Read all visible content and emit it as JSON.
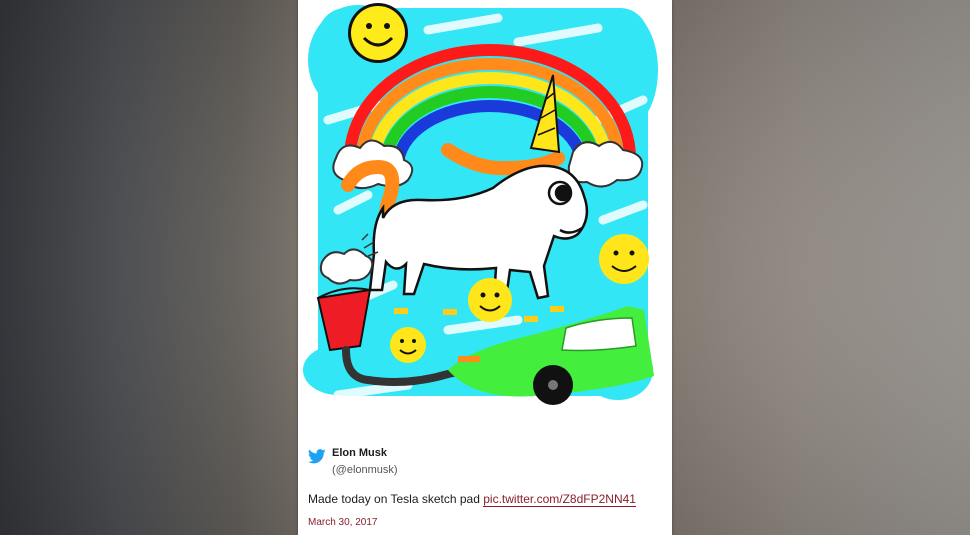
{
  "tweet": {
    "author_name": "Elon Musk",
    "author_handle": "(@elonmusk)",
    "text": "Made today on Tesla sketch pad",
    "link_text": "pic.twitter.com/Z8dFP2NN41",
    "date": "March 30, 2017"
  },
  "icons": {
    "platform": "twitter-bird-icon"
  },
  "colors": {
    "twitter_blue": "#1da1f2",
    "link": "#8a1e2b",
    "sky_scribble": "#33e6f5"
  }
}
